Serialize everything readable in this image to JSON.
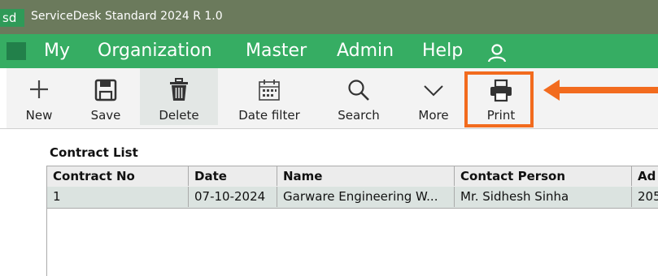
{
  "window": {
    "app_mark": "sd",
    "title": "ServiceDesk Standard 2024 R 1.0"
  },
  "menu": {
    "items": [
      "My",
      "Organization",
      "Master",
      "Admin",
      "Help"
    ],
    "user_icon": "user-icon"
  },
  "toolbar": {
    "buttons": [
      {
        "label": "New",
        "icon": "plus-icon"
      },
      {
        "label": "Save",
        "icon": "floppy-icon"
      },
      {
        "label": "Delete",
        "icon": "trash-icon"
      },
      {
        "label": "Date filter",
        "icon": "calendar-icon"
      },
      {
        "label": "Search",
        "icon": "search-icon"
      },
      {
        "label": "More",
        "icon": "chevron-down-icon"
      },
      {
        "label": "Print",
        "icon": "printer-icon"
      }
    ]
  },
  "annotation": {
    "highlight_color": "#f26b1e",
    "highlighted_item": "Print"
  },
  "contract_list": {
    "title": "Contract List",
    "columns": [
      "Contract No",
      "Date",
      "Name",
      "Contact Person",
      "Ad"
    ],
    "rows": [
      [
        "1",
        "07-10-2024",
        "Garware Engineering W...",
        "Mr. Sidhesh Sinha",
        "205"
      ]
    ]
  },
  "colors": {
    "titlebar": "#6b7a5c",
    "menubar": "#36ad63",
    "selected_row": "#dbe3e0"
  }
}
